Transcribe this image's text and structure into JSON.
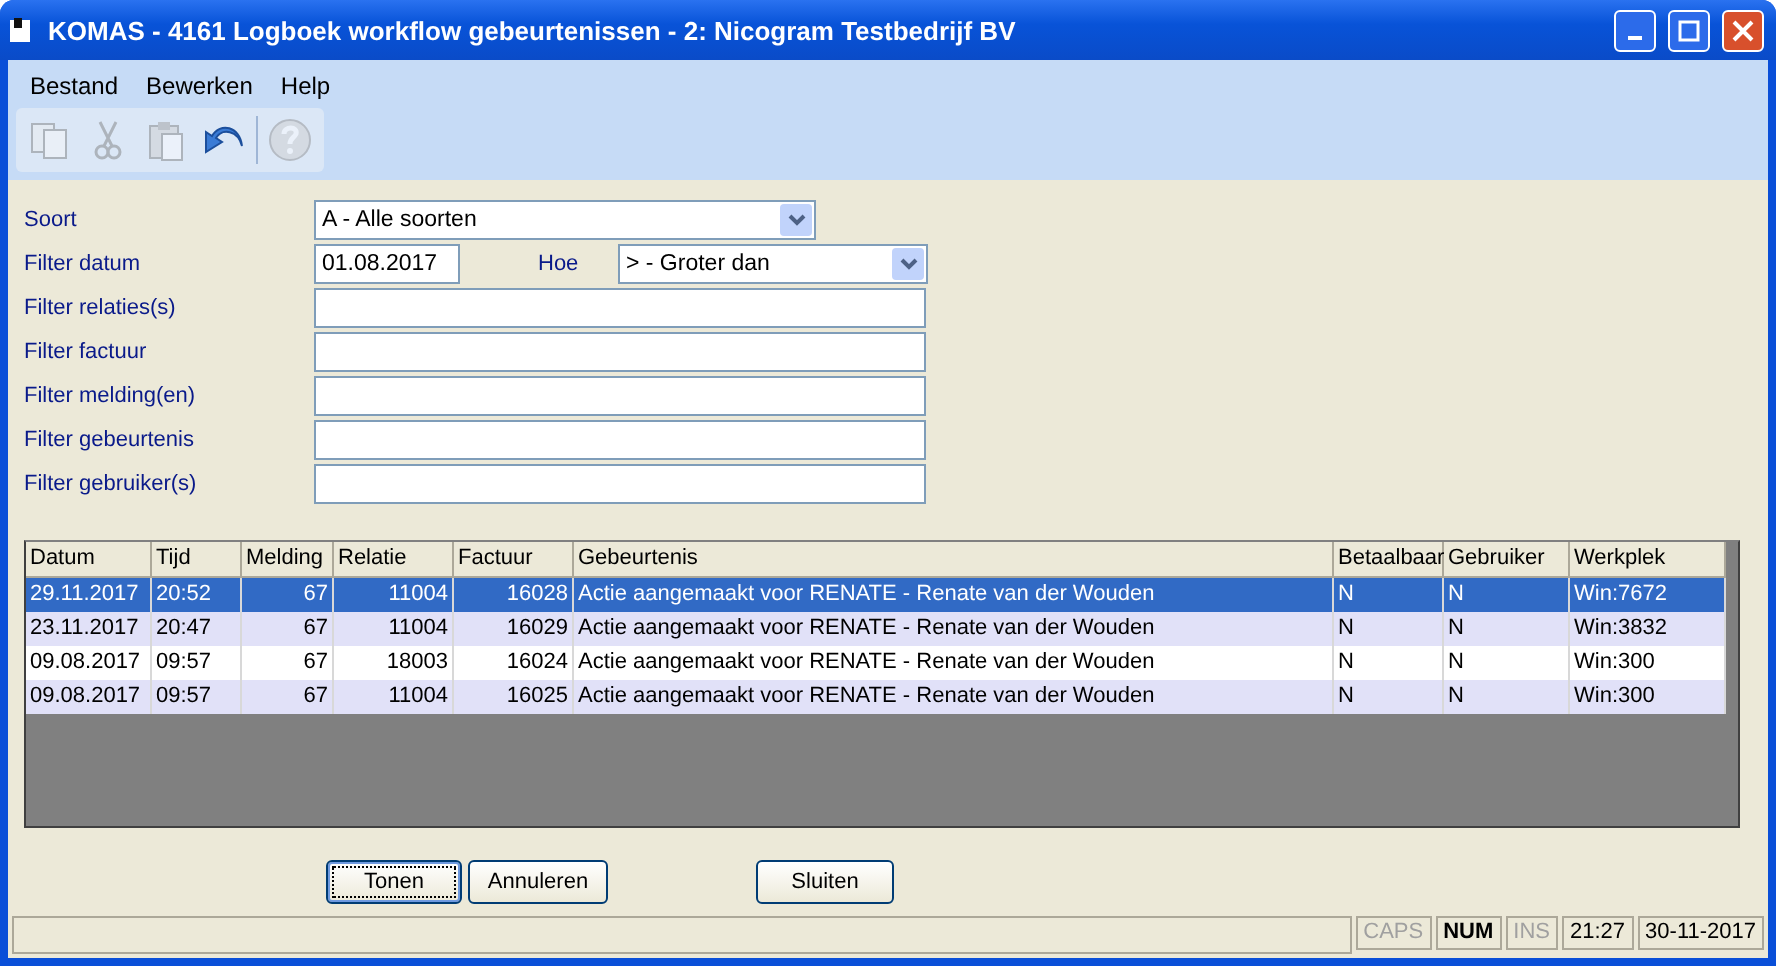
{
  "window": {
    "title": "KOMAS - 4161 Logboek workflow gebeurtenissen - 2: Nicogram Testbedrijf BV"
  },
  "menu": [
    "Bestand",
    "Bewerken",
    "Help"
  ],
  "toolbar": [
    {
      "kind": "copy",
      "disabled": true
    },
    {
      "kind": "cut",
      "disabled": true
    },
    {
      "kind": "paste",
      "disabled": true
    },
    {
      "kind": "undo",
      "disabled": false
    },
    {
      "kind": "separator"
    },
    {
      "kind": "help",
      "disabled": true
    }
  ],
  "filters": [
    {
      "label": "Soort",
      "kind": "select",
      "value": "A - Alle soorten"
    },
    {
      "label": "Filter datum",
      "kind": "date",
      "value": "01.08.2017",
      "extra_label": "Hoe",
      "extra_value": "> - Groter dan"
    },
    {
      "label": "Filter relaties(s)",
      "kind": "text"
    },
    {
      "label": "Filter factuur",
      "kind": "text"
    },
    {
      "label": "Filter melding(en)",
      "kind": "text"
    },
    {
      "label": "Filter gebeurtenis",
      "kind": "text"
    },
    {
      "label": "Filter gebruiker(s)",
      "kind": "text"
    }
  ],
  "table": {
    "columns": [
      {
        "label": "Datum"
      },
      {
        "label": "Tijd"
      },
      {
        "label": "Melding"
      },
      {
        "label": "Relatie"
      },
      {
        "label": "Factuur"
      },
      {
        "label": "Gebeurtenis"
      },
      {
        "label": "Betaalbaar"
      },
      {
        "label": "Gebruiker"
      },
      {
        "label": "Werkplek"
      }
    ],
    "rows": [
      {
        "selected": true,
        "cells": [
          "29.11.2017",
          "20:52",
          "67",
          "11004",
          "16028",
          "Actie aangemaakt voor RENATE - Renate van der Wouden",
          "N",
          "N",
          "Win:7672"
        ]
      },
      {
        "selected": false,
        "cells": [
          "23.11.2017",
          "20:47",
          "67",
          "11004",
          "16029",
          "Actie aangemaakt voor RENATE - Renate van der Wouden",
          "N",
          "N",
          "Win:3832"
        ]
      },
      {
        "selected": false,
        "cells": [
          "09.08.2017",
          "09:57",
          "67",
          "18003",
          "16024",
          "Actie aangemaakt voor RENATE - Renate van der Wouden",
          "N",
          "N",
          "Win:300"
        ]
      },
      {
        "selected": false,
        "cells": [
          "09.08.2017",
          "09:57",
          "67",
          "11004",
          "16025",
          "Actie aangemaakt voor RENATE - Renate van der Wouden",
          "N",
          "N",
          "Win:300"
        ]
      }
    ]
  },
  "buttons": [
    {
      "label": "Tonen",
      "focused": true
    },
    {
      "label": "Annuleren",
      "focused": false
    },
    {
      "label": "Sluiten",
      "focused": false
    }
  ],
  "status_bar": [
    {
      "label": "CAPS",
      "on": false
    },
    {
      "label": "NUM",
      "on": true
    },
    {
      "label": "INS",
      "on": false
    },
    {
      "label": "21:27",
      "on": true
    },
    {
      "label": "30-11-2017",
      "on": true
    }
  ]
}
